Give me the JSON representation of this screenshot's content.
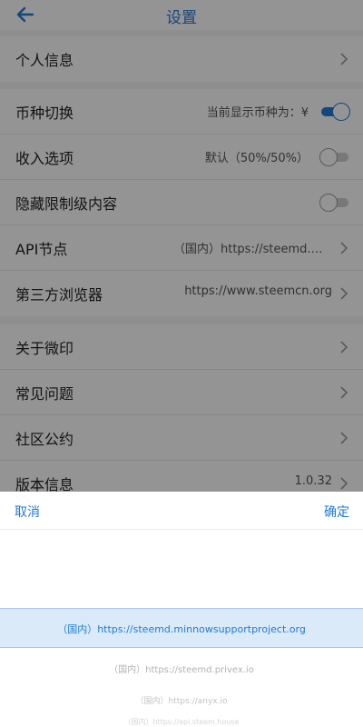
{
  "header": {
    "title": "设置"
  },
  "groups": {
    "profile": {
      "label": "个人信息"
    },
    "currency": {
      "label": "币种切换",
      "value": "当前显示币种为：¥",
      "toggle": "on"
    },
    "income": {
      "label": "收入选项",
      "value": "默认（50%/50%）",
      "toggle": "off"
    },
    "hidden": {
      "label": "隐藏限制级内容",
      "toggle": "off"
    },
    "api": {
      "label": "API节点",
      "value": "（国内）https://steemd.minnowsupportproject.org"
    },
    "browser": {
      "label": "第三方浏览器",
      "value": "https://www.steemcn.org"
    },
    "about": {
      "label": "关于微印"
    },
    "faq": {
      "label": "常见问题"
    },
    "convention": {
      "label": "社区公约"
    },
    "version": {
      "label": "版本信息",
      "value": "1.0.32"
    }
  },
  "picker": {
    "cancel": "取消",
    "confirm": "确定",
    "options": [
      "（国内）https://steemd.minnowsupportproject.org",
      "（国内）https://steemd.privex.io",
      "（国内）https://anyx.io",
      "（国内）https://api.steem.house"
    ],
    "selected_index": 0
  },
  "colors": {
    "accent": "#1f7ad8",
    "background": "#f5f5f5",
    "overlay": "rgba(0,0,0,0.42)"
  }
}
